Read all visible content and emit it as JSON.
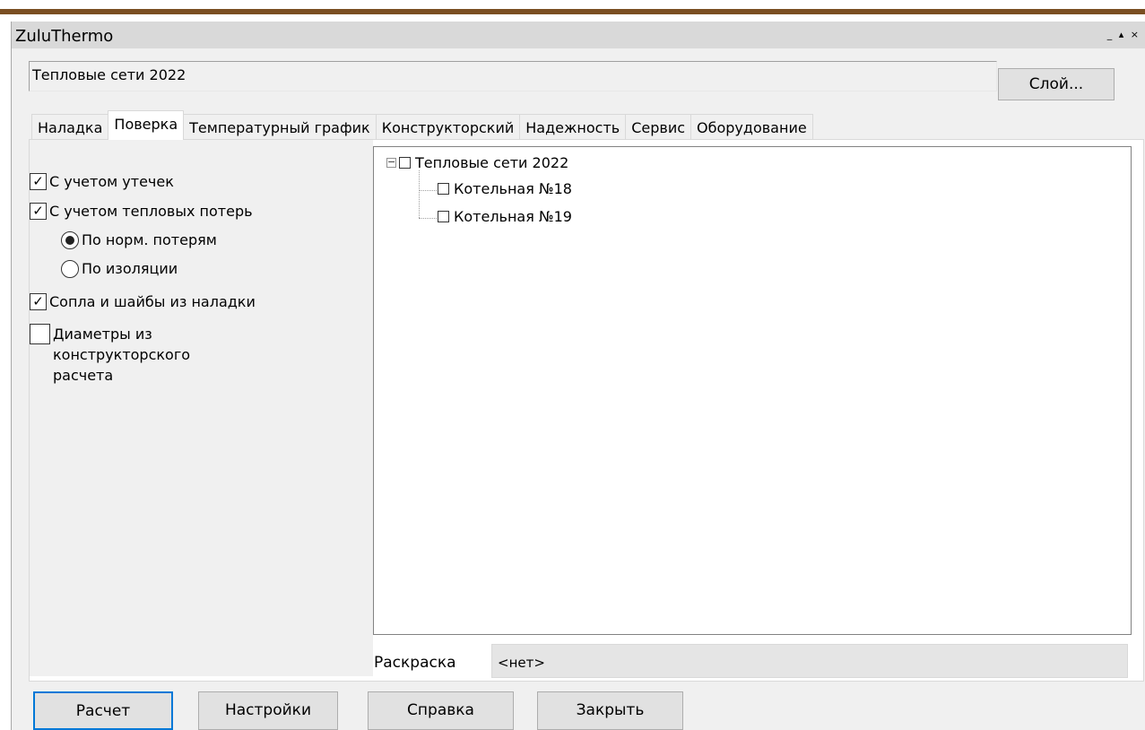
{
  "window": {
    "title": "ZuluThermo",
    "controls": [
      "_",
      "▴",
      "×"
    ]
  },
  "layer": {
    "value": "Тепловые сети 2022",
    "button_label": "Слой..."
  },
  "tabs": [
    {
      "label": "Наладка",
      "active": false
    },
    {
      "label": "Поверка",
      "active": true
    },
    {
      "label": "Температурный график",
      "active": false
    },
    {
      "label": "Конструкторский",
      "active": false
    },
    {
      "label": "Надежность",
      "active": false
    },
    {
      "label": "Сервис",
      "active": false
    },
    {
      "label": "Оборудование",
      "active": false
    }
  ],
  "options": {
    "leaks": {
      "label": "С учетом утечек",
      "checked": true
    },
    "heat_loss": {
      "label": "С учетом тепловых потерь",
      "checked": true
    },
    "radio_norm": {
      "label": "По норм. потерям",
      "selected": true
    },
    "radio_insulation": {
      "label": "По изоляции",
      "selected": false
    },
    "nozzles": {
      "label": "Сопла и шайбы из наладки",
      "checked": true
    },
    "diameters": {
      "label_1": "Диаметры из",
      "label_2": "конструкторского",
      "label_3": "расчета",
      "checked": false
    }
  },
  "tree": {
    "root": {
      "label": "Тепловые сети 2022",
      "expander": "−"
    },
    "children": [
      {
        "label": "Котельная №18"
      },
      {
        "label": "Котельная №19"
      }
    ]
  },
  "coloring": {
    "label": "Раскраска",
    "value": "<нет>"
  },
  "buttons": {
    "calc": "Расчет",
    "settings": "Настройки",
    "help": "Справка",
    "close": "Закрыть"
  }
}
